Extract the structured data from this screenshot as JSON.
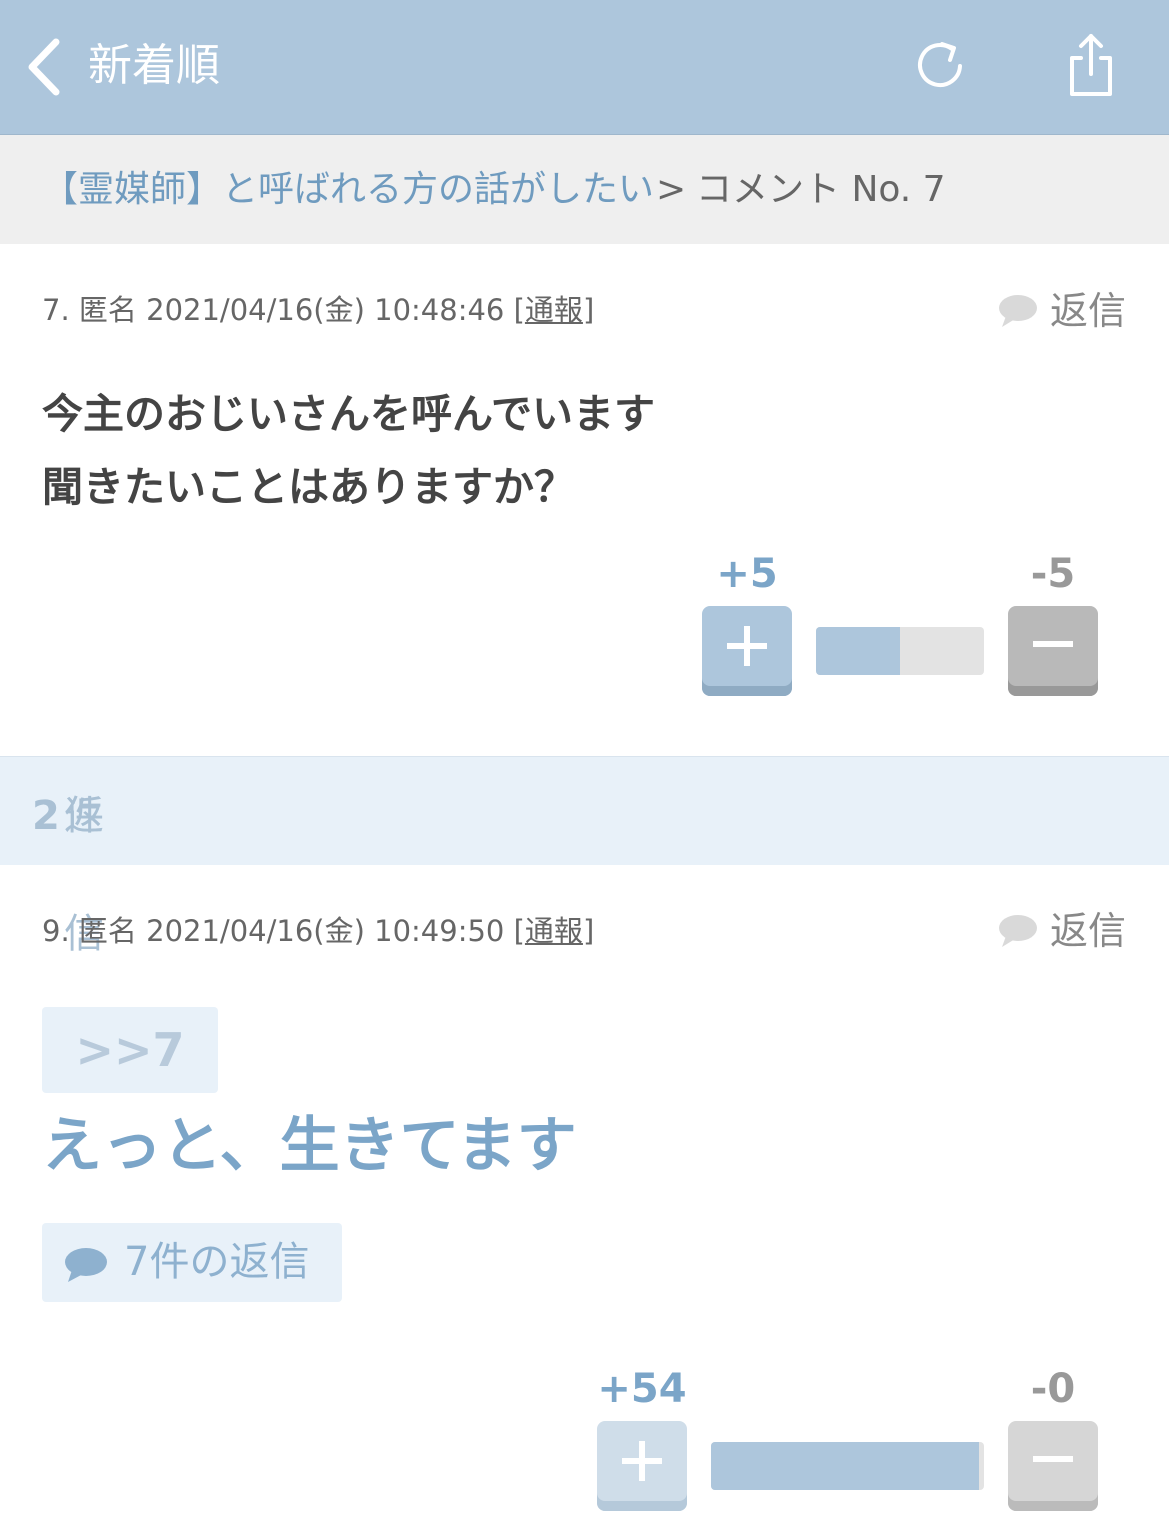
{
  "nav": {
    "title": "新着順",
    "back_icon": "chevron-left-icon",
    "reload_icon": "reload-icon",
    "share_icon": "share-icon"
  },
  "breadcrumb": {
    "topic": "【霊媒師】と呼ばれる方の話がしたい",
    "separator": ">",
    "current": "コメント No. 7"
  },
  "comment": {
    "number": "7.",
    "author": "匿名",
    "datetime": "2021/04/16(金) 10:48:46",
    "report_open": "[",
    "report": "通報",
    "report_close": "]",
    "reply_label": "返信",
    "body_line1": "今主のおじいさんを呼んでいます",
    "body_line2": "聞きたいことはありますか？",
    "plus_score": "+5",
    "minus_score": "-5",
    "vote_ratio": 0.5
  },
  "replies_header": {
    "prefix": "返信",
    "count": "2",
    "suffix": "件"
  },
  "reply": {
    "number": "9.",
    "author": "匿名",
    "datetime": "2021/04/16(金) 10:49:50",
    "report_open": "[",
    "report": "通報",
    "report_close": "]",
    "reply_label": "返信",
    "anchor": ">>7",
    "body": "えっと、生きてます",
    "thread_label": "7件の返信",
    "plus_score": "+54",
    "minus_score": "-0",
    "vote_ratio": 1.0
  },
  "colors": {
    "header": "#adc6dc",
    "accent": "#7ba5c8",
    "link": "#6f9bbf"
  }
}
